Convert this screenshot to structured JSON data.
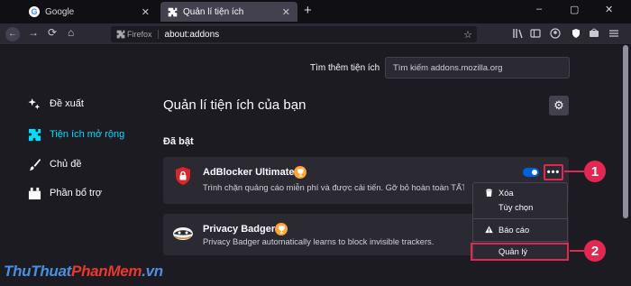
{
  "tabs": [
    {
      "title": "Google",
      "close": "✕"
    },
    {
      "title": "Quản lí tiện ích",
      "close": "✕"
    }
  ],
  "newtab": "+",
  "window_controls": [
    "–",
    "▢",
    "✕"
  ],
  "nav": {
    "back": "←",
    "forward": "→",
    "reload": "⟳",
    "home": "⌂",
    "identity": "Firefox",
    "url": "about:addons",
    "star": "☆"
  },
  "find_label": "Tìm thêm tiện ích",
  "search_placeholder": "Tìm kiếm addons.mozilla.org",
  "sidebar": [
    {
      "label": "Đề xuất",
      "icon": "sparkle-icon"
    },
    {
      "label": "Tiện ích mở rộng",
      "icon": "puzzle-icon",
      "active": true
    },
    {
      "label": "Chủ đề",
      "icon": "brush-icon"
    },
    {
      "label": "Phần bổ trợ",
      "icon": "plugin-icon"
    }
  ],
  "heading": "Quản lí tiện ích của bạn",
  "section_enabled": "Đã bật",
  "addons": [
    {
      "name": "AdBlocker Ultimate",
      "desc": "Trình chặn quảng cáo miễn phí và được cải tiến. Gỡ bỏ hoàn toàn TẤT C",
      "enabled": true
    },
    {
      "name": "Privacy Badger",
      "desc": "Privacy Badger automatically learns to block invisible trackers."
    }
  ],
  "more_button": "•••",
  "menu": {
    "remove": "Xóa",
    "options": "Tùy chọn",
    "report": "Báo cáo",
    "manage": "Quản lý"
  },
  "callouts": [
    "1",
    "2"
  ],
  "watermark": {
    "part1": "ThuThuat",
    "part2": "PhanMem",
    "part3": ".vn",
    "colors": {
      "part1": "#4a90e2",
      "part2": "#e8392f",
      "part3": "#4a90e2"
    }
  },
  "colors": {
    "accent": "#00ddff",
    "toggle": "#0060df",
    "highlight": "#e22850",
    "badge": "#ffa436"
  }
}
